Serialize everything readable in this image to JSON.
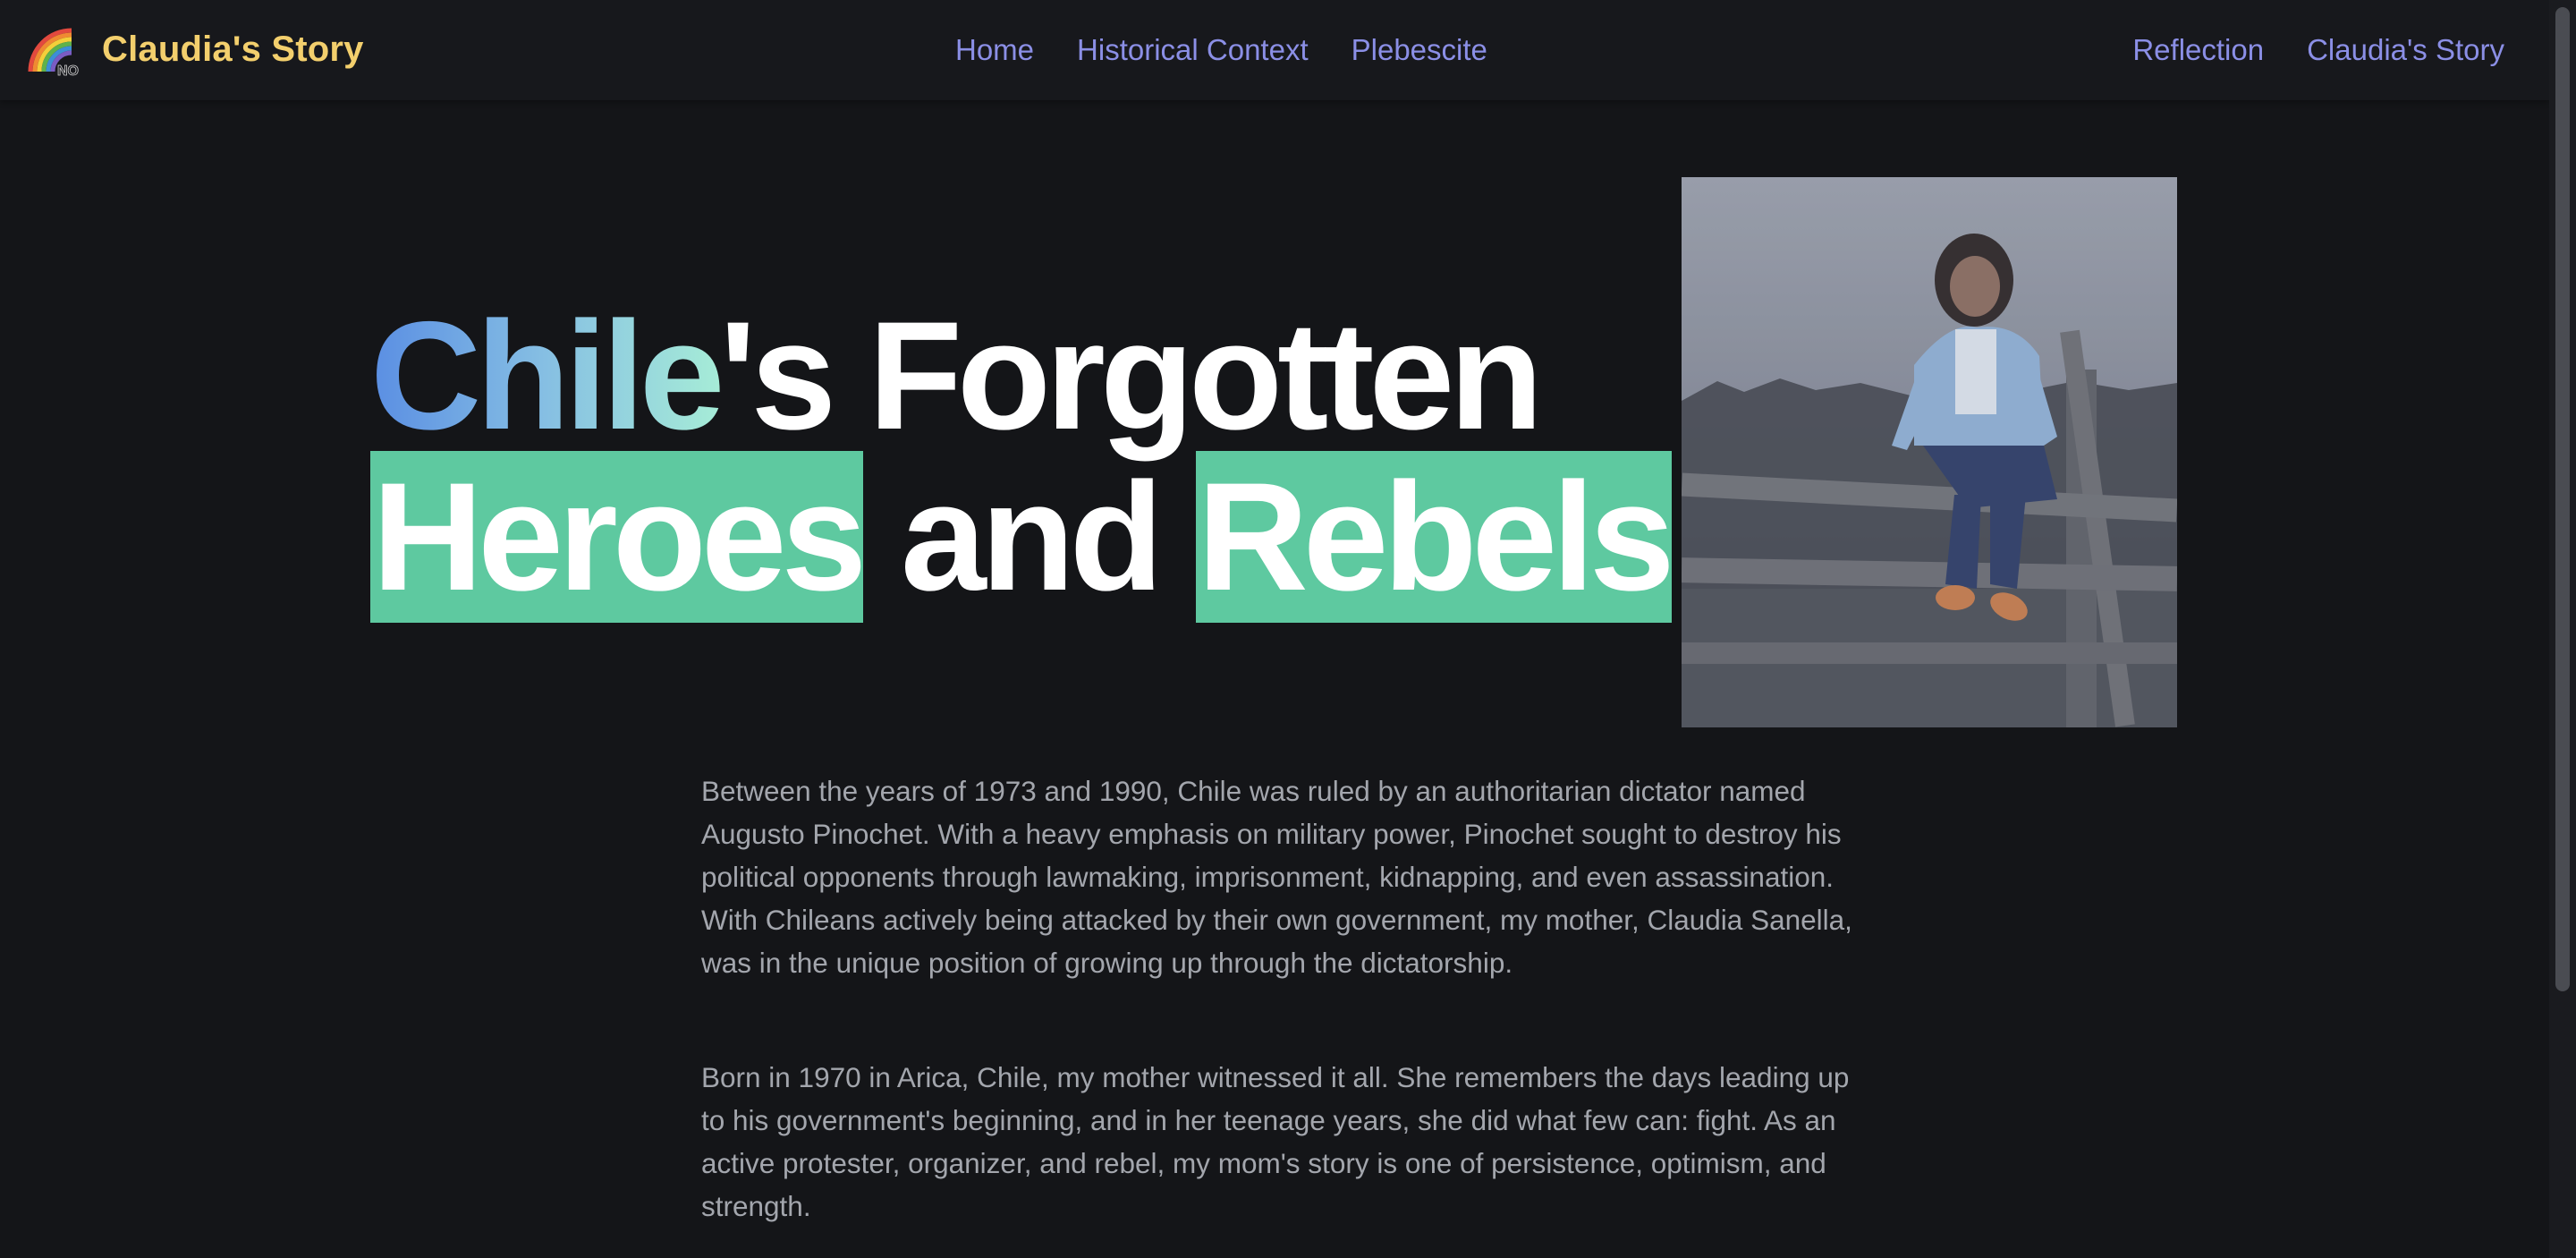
{
  "nav": {
    "brand": "Claudia's Story",
    "logo_badge": "NO",
    "center_links": [
      "Home",
      "Historical Context",
      "Plebescite"
    ],
    "right_links": [
      "Reflection",
      "Claudia's Story"
    ]
  },
  "hero": {
    "title_word_1": "Chile",
    "title_word_1_suffix": "'s Forgotten",
    "title_word_2": "Heroes",
    "title_word_3": " and ",
    "title_word_4": "Rebels"
  },
  "content": {
    "paragraphs": [
      "Between the years of 1973 and 1990, Chile was ruled by an authoritarian dictator named Augusto Pinochet. With a heavy emphasis on military power, Pinochet sought to destroy his political opponents through lawmaking, imprisonment, kidnapping, and even assassination. With Chileans actively being attacked by their own government, my mother, Claudia Sanella, was in the unique position of growing up through the dictatorship.",
      "Born in 1970 in Arica, Chile, my mother witnessed it all. She remembers the days leading up to his government's beginning, and in her teenage years, she did what few can: fight. As an active protester, organizer, and rebel, my mom's story is one of persistence, optimism, and strength."
    ]
  },
  "colors": {
    "background": "#141518",
    "brand": "#f3cf6d",
    "nav_link": "#8b8fe6",
    "highlight": "#5ec9a0",
    "body_text": "#a3a6ad"
  }
}
